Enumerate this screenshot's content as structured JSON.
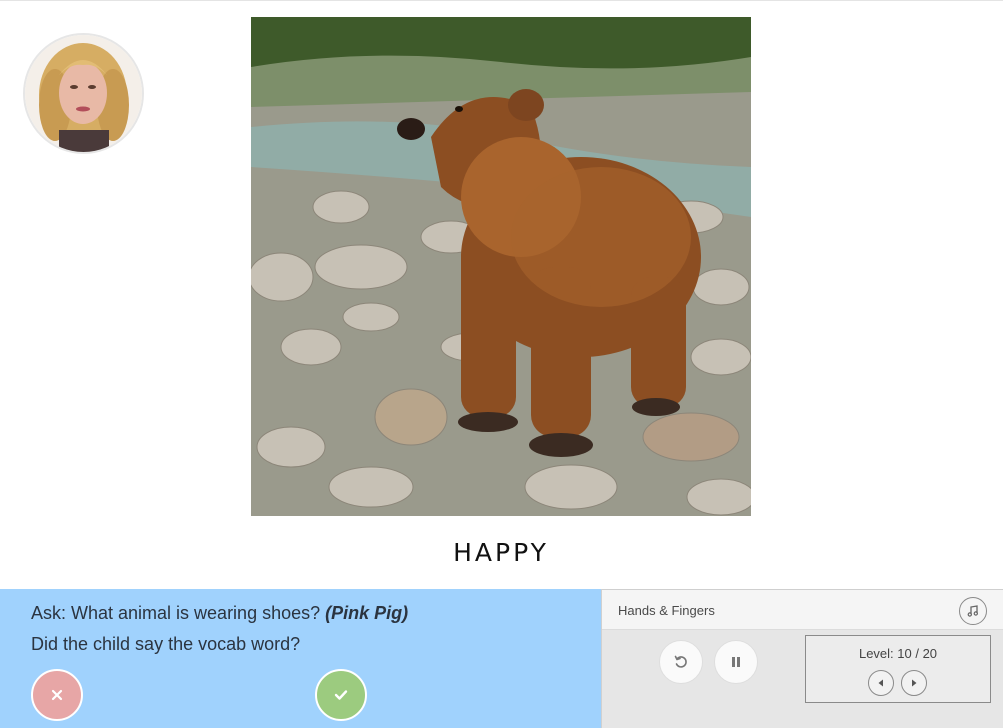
{
  "word": "HAPPY",
  "prompt": {
    "ask_text": "Ask: What animal is wearing shoes?",
    "answer_text": "(Pink Pig)",
    "question2": "Did the child say the vocab word?"
  },
  "answer_buttons": {
    "no_icon": "close-icon",
    "yes_icon": "check-icon"
  },
  "player": {
    "title": "Hands & Fingers",
    "level_text": "Level: 10 / 20"
  },
  "colors": {
    "prompt_panel": "#a0d2fd",
    "no_button": "#e7a6a6",
    "yes_button": "#9ccb7f",
    "player_panel": "#e6e6e6"
  }
}
